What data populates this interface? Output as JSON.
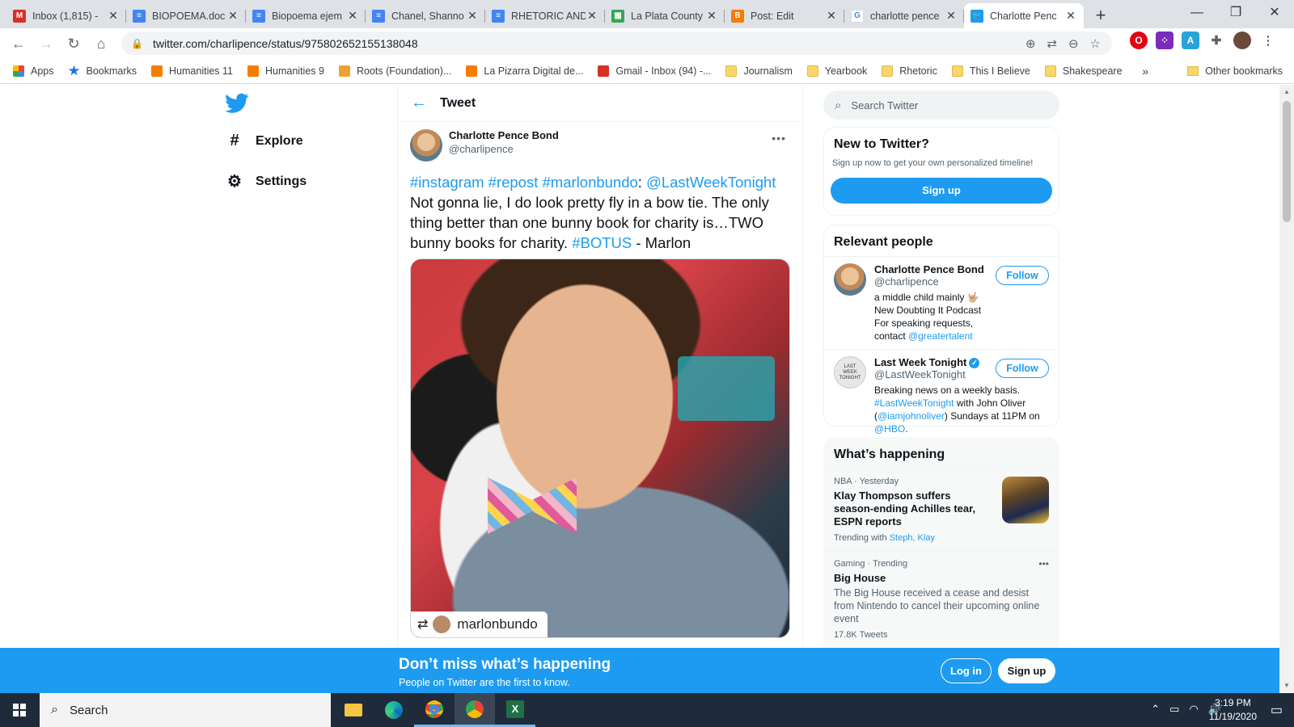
{
  "browser": {
    "tabs": [
      {
        "label": "Inbox (1,815) -",
        "favicon": "gmail-icon",
        "color": "#d93025",
        "glyph": "M"
      },
      {
        "label": "BIOPOEMA.doc",
        "favicon": "docs-icon",
        "color": "#4285f4",
        "glyph": "≡"
      },
      {
        "label": "Biopoema ejem",
        "favicon": "docs-icon",
        "color": "#4285f4",
        "glyph": "≡"
      },
      {
        "label": "Chanel, Shanno",
        "favicon": "docs-icon",
        "color": "#4285f4",
        "glyph": "≡"
      },
      {
        "label": "RHETORIC AND",
        "favicon": "docs-icon",
        "color": "#4285f4",
        "glyph": "≡"
      },
      {
        "label": "La Plata County",
        "favicon": "sheets-icon",
        "color": "#34a853",
        "glyph": "▦"
      },
      {
        "label": "Post: Edit",
        "favicon": "blogger-icon",
        "color": "#f57c00",
        "glyph": "B"
      },
      {
        "label": "charlotte pence",
        "favicon": "google-icon",
        "color": "#ffffff",
        "glyph": "G"
      },
      {
        "label": "Charlotte Penc",
        "favicon": "twitter-icon",
        "color": "#1d9bf0",
        "glyph": "🐦"
      }
    ],
    "url": "twitter.com/charlipence/status/975802652155138048",
    "bookmarks": [
      {
        "label": "Apps",
        "icon": "apps-grid-icon"
      },
      {
        "label": "Bookmarks",
        "icon": "star-icon"
      },
      {
        "label": "Humanities 11",
        "icon": "blogger-icon"
      },
      {
        "label": "Humanities 9",
        "icon": "blogger-icon"
      },
      {
        "label": "Roots (Foundation)...",
        "icon": "roots-icon"
      },
      {
        "label": "La Pizarra Digital de...",
        "icon": "blogger-icon"
      },
      {
        "label": "Gmail - Inbox (94) -...",
        "icon": "gmail-icon"
      },
      {
        "label": "Journalism",
        "icon": "folder-icon"
      },
      {
        "label": "Yearbook",
        "icon": "folder-icon"
      },
      {
        "label": "Rhetoric",
        "icon": "folder-icon"
      },
      {
        "label": "This I Believe",
        "icon": "folder-icon"
      },
      {
        "label": "Shakespeare",
        "icon": "folder-icon"
      }
    ],
    "more_bookmarks": "»",
    "other_bookmarks": "Other bookmarks"
  },
  "twitter": {
    "nav": {
      "explore": "Explore",
      "settings": "Settings"
    },
    "header_title": "Tweet",
    "author": {
      "name": "Charlotte Pence Bond",
      "handle": "@charlipence"
    },
    "tweet_parts": [
      {
        "text": "#instagram",
        "link": true
      },
      {
        "text": " ",
        "link": false
      },
      {
        "text": "#repost",
        "link": true
      },
      {
        "text": " ",
        "link": false
      },
      {
        "text": "#marlonbundo",
        "link": true
      },
      {
        "text": ": ",
        "link": false
      },
      {
        "text": "@LastWeekTonight",
        "link": true
      },
      {
        "text": " Not gonna lie, I do look pretty fly in a bow tie. The only thing better than one bunny book for charity is…TWO bunny books for charity. ",
        "link": false
      },
      {
        "text": "#BOTUS",
        "link": true
      },
      {
        "text": " - Marlon",
        "link": false
      }
    ],
    "photo_badge": "marlonbundo",
    "search_placeholder": "Search Twitter",
    "new_to_twitter": {
      "title": "New to Twitter?",
      "subtitle": "Sign up now to get your own personalized timeline!",
      "button": "Sign up"
    },
    "relevant_people": {
      "title": "Relevant people",
      "people": [
        {
          "name": "Charlotte Pence Bond",
          "handle": "@charlipence",
          "bio_text": "a middle child mainly 🤟🏼 New Doubting It Podcast For speaking requests, contact ",
          "bio_link": "@greatertalent",
          "follow": "Follow",
          "verified": false
        },
        {
          "name": "Last Week Tonight",
          "handle": "@LastWeekTonight",
          "bio_text": "Breaking news on a weekly basis. ",
          "bio_link": "#LastWeekTonight",
          "bio_text2": " with John Oliver (",
          "bio_link2": "@iamjohnoliver",
          "bio_text3": ") Sundays at 11PM on ",
          "bio_link3": "@HBO",
          "bio_text4": ".",
          "follow": "Follow",
          "verified": true
        }
      ]
    },
    "whats_happening": {
      "title": "What’s happening",
      "trends": [
        {
          "meta": "NBA · Yesterday",
          "title": "Klay Thompson suffers season-ending Achilles tear, ESPN reports",
          "trending_with_label": "Trending with",
          "trending_with_links": "Steph, Klay"
        },
        {
          "meta": "Gaming · Trending",
          "title": "Big House",
          "description": "The Big House received a cease and desist from Nintendo to cancel their upcoming online event",
          "count": "17.8K Tweets"
        }
      ]
    },
    "banner": {
      "title": "Don’t miss what’s happening",
      "subtitle": "People on Twitter are the first to know.",
      "login": "Log in",
      "signup": "Sign up"
    }
  },
  "taskbar": {
    "search": "Search",
    "time": "3:19 PM",
    "date": "11/19/2020"
  }
}
